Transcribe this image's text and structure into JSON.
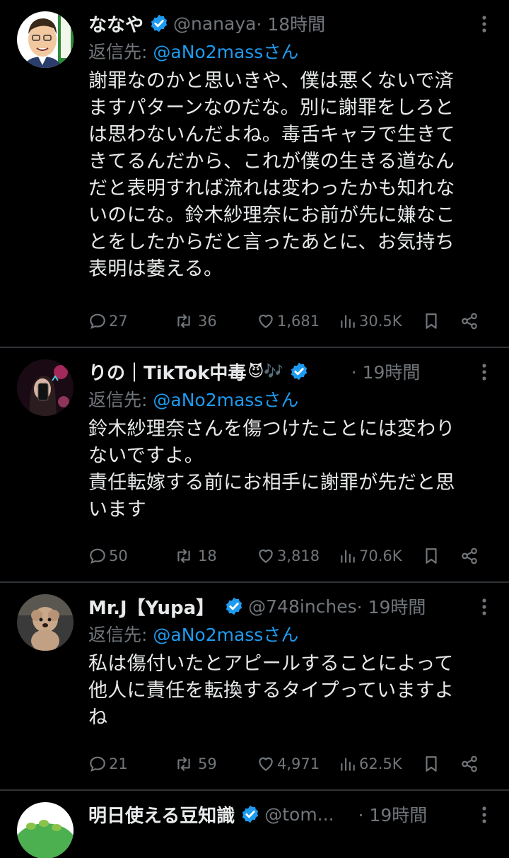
{
  "tweets": [
    {
      "name": "ななや",
      "handle": "@nanaya",
      "time": "· 18時間",
      "reply_prefix": "返信先: ",
      "reply_to": "@aNo2massさん",
      "lines": [
        "謝罪なのかと思いきや、僕は悪くないで済",
        "ますパターンなのだな。別に謝罪をしろと",
        "は思わないんだよね。毒舌キャラで生きて",
        "きてるんだから、これが僕の生きる道なん",
        "だと表明すれば流れは変わったかも知れな",
        "いのにな。鈴木紗理奈にお前が先に嫌なこ",
        "とをしたからだと言ったあとに、お気持ち",
        "表明は萎える。"
      ],
      "replies": "27",
      "retweets": "36",
      "likes": "1,681",
      "views": "30.5K"
    },
    {
      "name": "りの｜TikTok中毒",
      "name_emoji": "😈🎶",
      "handle": "",
      "time": "· 19時間",
      "reply_prefix": "返信先: ",
      "reply_to": "@aNo2massさん",
      "lines": [
        "鈴木紗理奈さんを傷つけたことには変わり",
        "ないですよ。",
        "責任転嫁する前にお相手に謝罪が先だと思",
        "います"
      ],
      "replies": "50",
      "retweets": "18",
      "likes": "3,818",
      "views": "70.6K"
    },
    {
      "name": "Mr.J【Yupa】",
      "handle": "@748inches",
      "time": "· 19時間",
      "reply_prefix": "返信先: ",
      "reply_to": "@aNo2massさん",
      "lines": [
        "私は傷付いたとアピールすることによって",
        "他人に責任を転換するタイプっていますよ",
        "ね"
      ],
      "replies": "21",
      "retweets": "59",
      "likes": "4,971",
      "views": "62.5K"
    },
    {
      "name": "明日使える豆知識",
      "handle": "@tom...",
      "time": "· 19時間"
    }
  ],
  "colors": {
    "background": "#000000",
    "text": "#e7e9ea",
    "muted": "#71767b",
    "accent": "#1d9bf0",
    "divider": "#2f3336"
  },
  "icons": {
    "verified": "verified-badge-icon",
    "reply": "reply-icon",
    "retweet": "retweet-icon",
    "like": "heart-icon",
    "views": "views-icon",
    "bookmark": "bookmark-icon",
    "share": "share-icon",
    "more": "more-icon"
  }
}
